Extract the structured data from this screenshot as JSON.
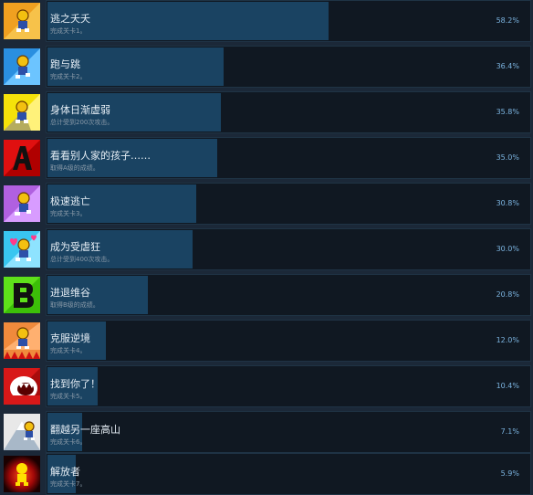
{
  "achievements": [
    {
      "title": "逃之夭夭",
      "desc": "完成关卡1。",
      "percent": 58.2,
      "percent_label": "58.2%",
      "icon": "runner-orange-icon",
      "icon_bg": "#f0a020",
      "icon_bg2": "#f7c24a"
    },
    {
      "title": "跑与跳",
      "desc": "完成关卡2。",
      "percent": 36.4,
      "percent_label": "36.4%",
      "icon": "runner-blue-icon",
      "icon_bg": "#2a8fe0",
      "icon_bg2": "#6cc4ff"
    },
    {
      "title": "身体日渐虚弱",
      "desc": "总计受到200次攻击。",
      "percent": 35.8,
      "percent_label": "35.8%",
      "icon": "runner-yellow-icon",
      "icon_bg": "#f5e20a",
      "icon_bg2": "#fff27a"
    },
    {
      "title": "看看别人家的孩子……",
      "desc": "取得A级的成绩。",
      "percent": 35.0,
      "percent_label": "35.0%",
      "icon": "grade-a-icon",
      "icon_bg": "#e01010",
      "icon_bg2": "#b00000"
    },
    {
      "title": "极速逃亡",
      "desc": "完成关卡3。",
      "percent": 30.8,
      "percent_label": "30.8%",
      "icon": "runner-purple-icon",
      "icon_bg": "#b060e0",
      "icon_bg2": "#d89cff"
    },
    {
      "title": "成为受虐狂",
      "desc": "总计受到400次攻击。",
      "percent": 30.0,
      "percent_label": "30.0%",
      "icon": "runner-hearts-icon",
      "icon_bg": "#39c6f0",
      "icon_bg2": "#8ee3ff"
    },
    {
      "title": "进退维谷",
      "desc": "取得B级的成绩。",
      "percent": 20.8,
      "percent_label": "20.8%",
      "icon": "grade-b-icon",
      "icon_bg": "#5ee01a",
      "icon_bg2": "#3cbf08"
    },
    {
      "title": "克服逆境",
      "desc": "完成关卡4。",
      "percent": 12.0,
      "percent_label": "12.0%",
      "icon": "runner-spikes-icon",
      "icon_bg": "#f08a3c",
      "icon_bg2": "#ffb070"
    },
    {
      "title": "找到你了！",
      "desc": "完成关卡5。",
      "percent": 10.4,
      "percent_label": "10.4%",
      "icon": "monster-mouth-icon",
      "icon_bg": "#d81818",
      "icon_bg2": "#a80c0c"
    },
    {
      "title": "翻越另一座高山",
      "desc": "完成关卡6。",
      "percent": 7.1,
      "percent_label": "7.1%",
      "icon": "runner-mountain-icon",
      "icon_bg": "#e8e8e8",
      "icon_bg2": "#a8b8c8"
    },
    {
      "title": "解放者",
      "desc": "完成关卡7。",
      "percent": 5.9,
      "percent_label": "5.9%",
      "icon": "glowing-figure-icon",
      "icon_bg": "#c01010",
      "icon_bg2": "#1a0000"
    }
  ]
}
